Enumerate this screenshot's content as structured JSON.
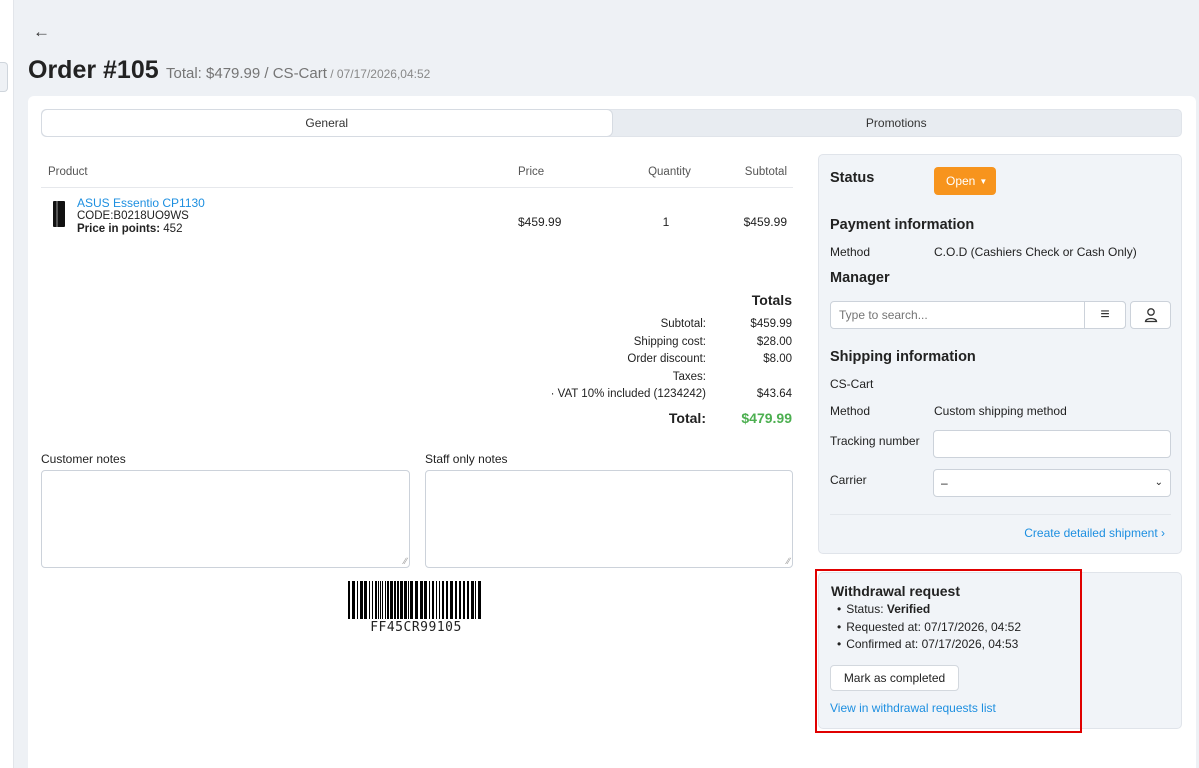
{
  "header": {
    "back_icon": "arrow-left-icon",
    "order_title": "Order #105",
    "total_store": "Total: $479.99 / CS-Cart",
    "date": "/ 07/17/2026,04:52"
  },
  "tabs": [
    {
      "label": "General",
      "active": true
    },
    {
      "label": "Promotions",
      "active": false
    }
  ],
  "products": {
    "columns": [
      "Product",
      "Price",
      "Quantity",
      "Subtotal"
    ],
    "rows": [
      {
        "name": "ASUS Essentio CP1130",
        "code": "CODE:B0218UO9WS",
        "points_label": "Price in points:",
        "points_value": "452",
        "price": "$459.99",
        "quantity": "1",
        "subtotal": "$459.99"
      }
    ]
  },
  "totals": {
    "heading": "Totals",
    "rows": [
      {
        "label": "Subtotal:",
        "value": "$459.99"
      },
      {
        "label": "Shipping cost:",
        "value": "$28.00"
      },
      {
        "label": "Order discount:",
        "value": "$8.00"
      },
      {
        "label": "Taxes:",
        "value": ""
      },
      {
        "label": "· VAT 10% included (1234242)",
        "value": "$43.64"
      }
    ],
    "total_label": "Total:",
    "total_value": "$479.99",
    "total_color": "#4caf50"
  },
  "notes": {
    "customer_label": "Customer notes",
    "staff_label": "Staff only notes"
  },
  "barcode": {
    "text": "FF45CR99105"
  },
  "sidebar": {
    "status_heading": "Status",
    "status_value": "Open",
    "status_color": "#f7941d",
    "payment_heading": "Payment information",
    "payment_method_label": "Method",
    "payment_method_value": "C.O.D (Cashiers Check or Cash Only)",
    "manager_heading": "Manager",
    "manager_placeholder": "Type to search...",
    "shipping_heading": "Shipping information",
    "shipping_store": "CS-Cart",
    "shipping_method_label": "Method",
    "shipping_method_value": "Custom shipping method",
    "tracking_label": "Tracking number",
    "tracking_value": "",
    "carrier_label": "Carrier",
    "carrier_value": "–",
    "create_shipment_link": "Create detailed shipment ›"
  },
  "withdrawal": {
    "title": "Withdrawal request",
    "status_label": "Status:",
    "status_value": "Verified",
    "requested": "Requested at: 07/17/2026, 04:52",
    "confirmed": "Confirmed at: 07/17/2026, 04:53",
    "button": "Mark as completed",
    "link": "View in withdrawal requests list",
    "highlight_color": "#e00000"
  },
  "link_color": "#1d8fe0"
}
